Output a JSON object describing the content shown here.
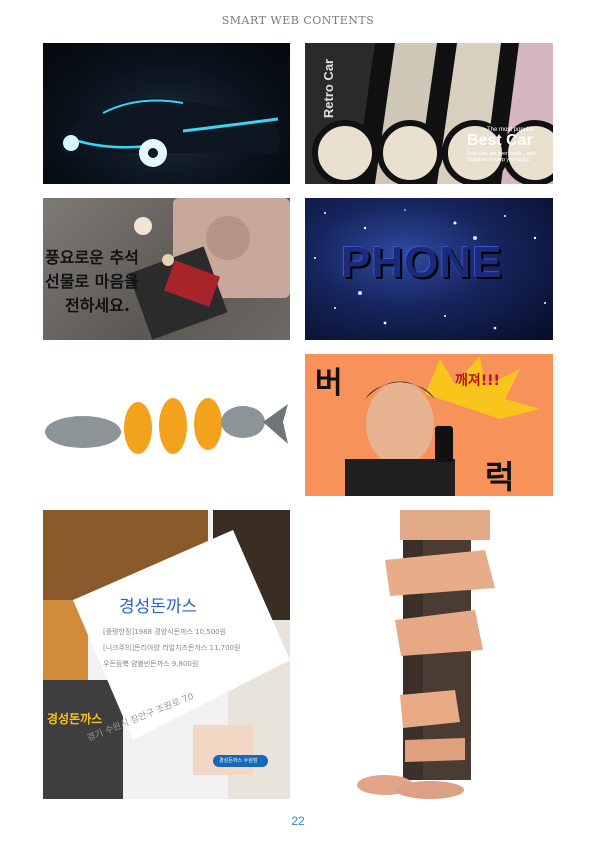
{
  "header": {
    "title": "SMART WEB CONTENTS"
  },
  "page_number": "22",
  "tiles": {
    "car_ad": {
      "title": "Best Car",
      "subtitle": "The most popular",
      "side_text": "Retro Car",
      "body": "Best cars are ever made...  and designed to keep you happy."
    },
    "chuseok": {
      "lines": [
        "풍요로운 추석",
        "선물로 마음을",
        "전하세요."
      ]
    },
    "phone": {
      "word": "PHONE"
    },
    "comic": {
      "char_top": "버",
      "char_bottom": "럭",
      "burst": "깨져!!!"
    },
    "restaurant": {
      "name": "경성돈까스",
      "menu": [
        "[중량한정]1988 경양식돈까스 10,500원",
        "[니크주의]돈리아양 리얼치즈돈까스 11,700원",
        "우돈듬뿍 얌볼빈돈까스 9,800원"
      ],
      "address": "경기 수원시 장안구 조원로 70",
      "map_label": "경성돈까스 수원점",
      "sign": "경성돈까스"
    }
  }
}
